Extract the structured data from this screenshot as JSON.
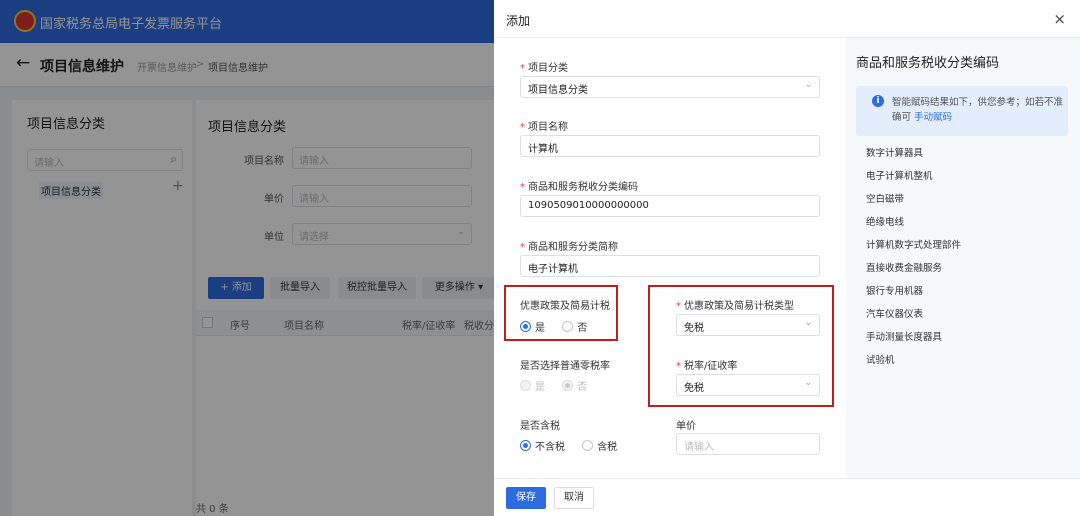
{
  "app": {
    "title": "国家税务总局电子发票服务平台"
  },
  "page": {
    "title": "项目信息维护",
    "breadcrumb": [
      "开票信息维护",
      "项目信息维护"
    ]
  },
  "left": {
    "title": "项目信息分类",
    "search_placeholder": "请输入",
    "tree_item": "项目信息分类"
  },
  "main": {
    "title": "项目信息分类",
    "fields": {
      "name_label": "项目名称",
      "name_placeholder": "请输入",
      "price_label": "单价",
      "price_placeholder": "请输入",
      "unit_label": "单位",
      "unit_placeholder": "请选择"
    },
    "buttons": {
      "add": "添加",
      "batch_import": "批量导入",
      "tax_import": "税控批量导入",
      "more": "更多操作"
    },
    "table_headers": [
      "序号",
      "项目名称",
      "税率/征收率",
      "税收分"
    ],
    "total": "共 0 条"
  },
  "drawer": {
    "title": "添加",
    "close": "×",
    "category": {
      "label": "项目分类",
      "value": "项目信息分类"
    },
    "name": {
      "label": "项目名称",
      "value": "计算机"
    },
    "tax_code": {
      "label": "商品和服务税收分类编码",
      "value": "1090509010000000000"
    },
    "short_name": {
      "label": "商品和服务分类简称",
      "value": "电子计算机"
    },
    "preferential": {
      "label": "优惠政策及简易计税",
      "yes": "是",
      "no": "否",
      "selected": "是"
    },
    "preferential_type": {
      "label": "优惠政策及简易计税类型",
      "value": "免税"
    },
    "zero_rate": {
      "label": "是否选择普通零税率",
      "yes": "是",
      "no": "否",
      "selected": "否"
    },
    "tax_rate": {
      "label": "税率/征收率",
      "value": "免税"
    },
    "tax_included": {
      "label": "是否含税",
      "no": "不含税",
      "yes": "含税",
      "selected": "不含税"
    },
    "unit_price": {
      "label": "单价",
      "placeholder": "请输入"
    },
    "save": "保存",
    "cancel": "取消"
  },
  "code_panel": {
    "title": "商品和服务税收分类编码",
    "info_text": "智能赋码结果如下，供您参考；如若不准确可",
    "info_link": "手动赋码",
    "items": [
      "数字计算器具",
      "电子计算机整机",
      "空白磁带",
      "绝缘电线",
      "计算机数字式处理部件",
      "直接收费金融服务",
      "银行专用机器",
      "汽车仪器仪表",
      "手动测量长度器具",
      "试验机"
    ]
  },
  "colors": {
    "primary": "#2d6cdf",
    "highlight_border": "#c41c1c",
    "required": "#e23c3c"
  }
}
